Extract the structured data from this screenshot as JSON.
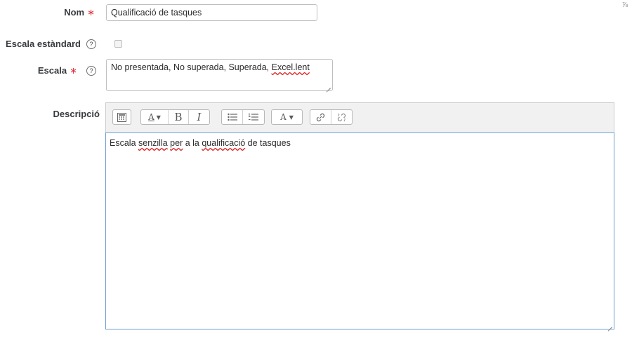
{
  "form": {
    "nom": {
      "label": "Nom",
      "required_mark": "∗",
      "value": "Qualificació de tasques"
    },
    "escala_estandard": {
      "label": "Escala estàndard",
      "help": "?"
    },
    "escala": {
      "label": "Escala",
      "required_mark": "∗",
      "help": "?",
      "value_parts": [
        "No presentada, No superada, Superada, ",
        "Excel.lent"
      ]
    },
    "descripcio": {
      "label": "Descripció",
      "toolbar": {
        "font_size": "A",
        "bold": "B",
        "italic": "I",
        "font_color": "A",
        "dropdown_arrow": "▼"
      },
      "content_parts": [
        "Escala ",
        "senzilla",
        " ",
        "per",
        " a la ",
        "qualificació",
        " de tasques"
      ]
    }
  },
  "corner_mark": "⅞"
}
